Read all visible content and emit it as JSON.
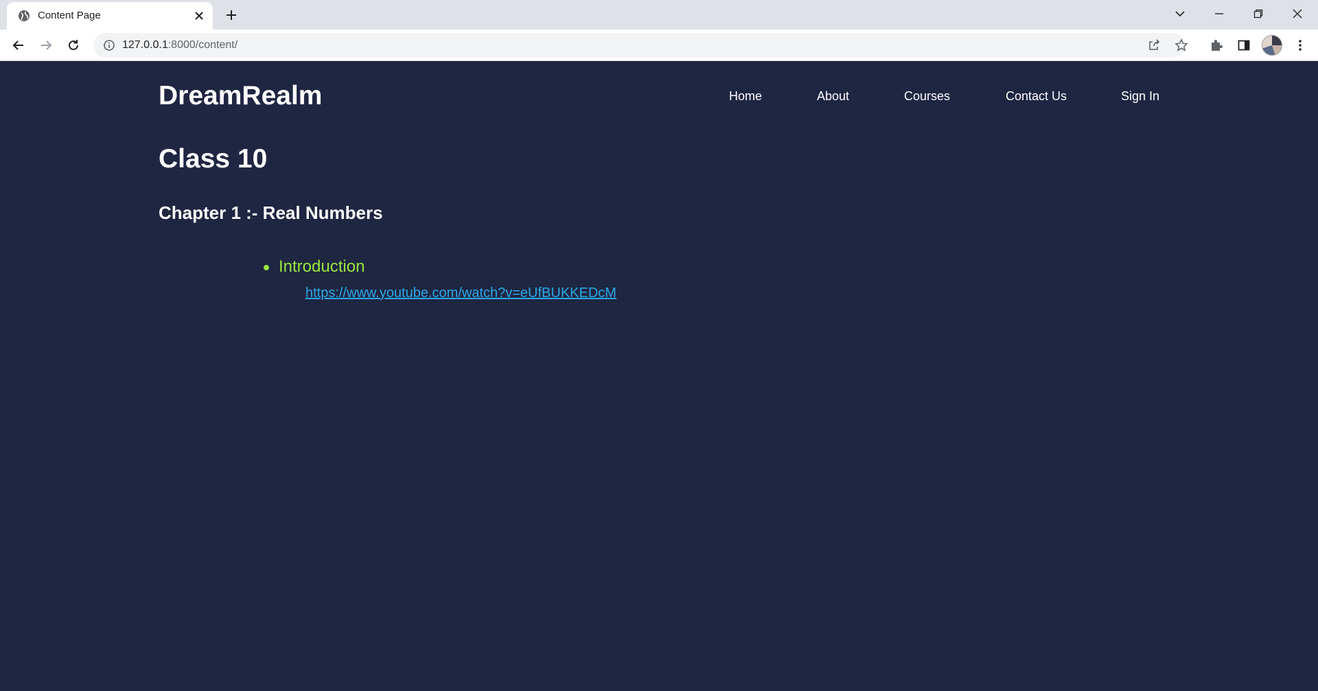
{
  "browser": {
    "tab_title": "Content Page",
    "url_host": "127.0.0.1",
    "url_rest": ":8000/content/"
  },
  "site": {
    "brand": "DreamRealm",
    "nav": [
      "Home",
      "About",
      "Courses",
      "Contact Us",
      "Sign In"
    ]
  },
  "content": {
    "class_title": "Class 10",
    "chapter_title": "Chapter 1 :- Real Numbers",
    "topics": [
      {
        "label": "Introduction",
        "link": "https://www.youtube.com/watch?v=eUfBUKKEDcM"
      }
    ]
  },
  "colors": {
    "page_bg": "#1f2642",
    "topic_green": "#9ae63d",
    "link_blue": "#2aa9e6"
  }
}
